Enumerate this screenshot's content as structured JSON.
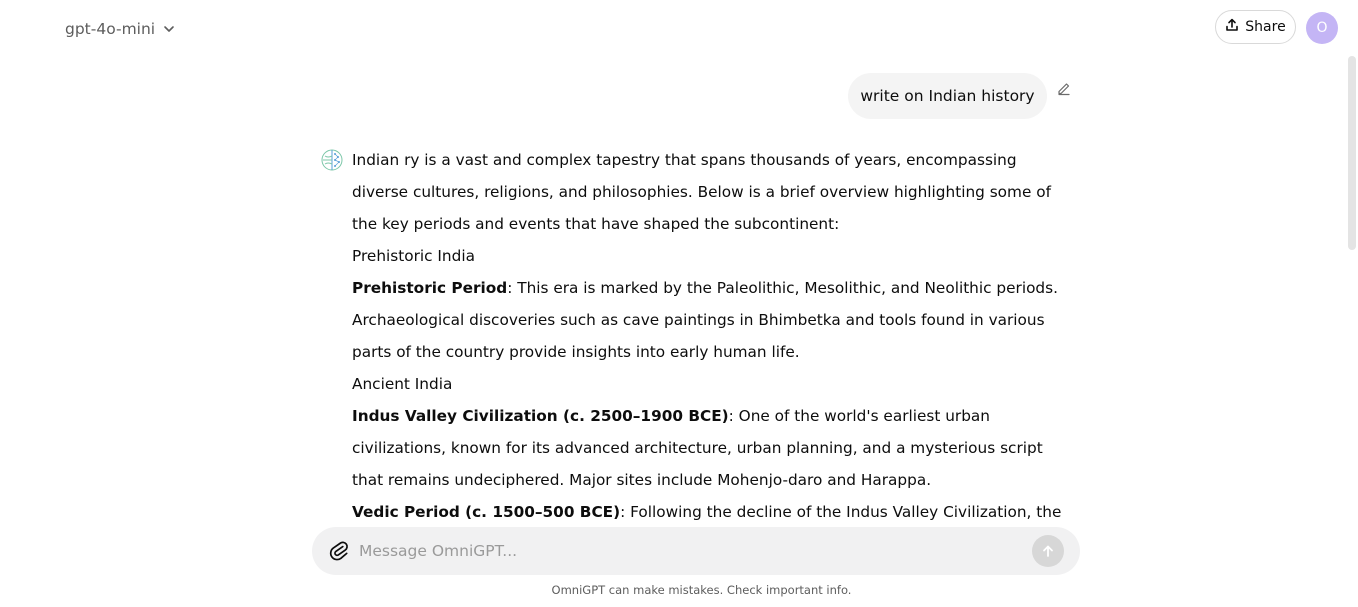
{
  "header": {
    "model_label": "gpt-4o-mini",
    "share_label": "Share",
    "avatar_initial": "O"
  },
  "user_message": {
    "text": "write on Indian history"
  },
  "assistant_message": {
    "intro": "Indian ry is a vast and complex tapestry that spans thousands of years, encompassing diverse cultures, religions, and philosophies. Below is a brief overview highlighting some of the key periods and events that have shaped the subcontinent:",
    "sections": [
      {
        "heading": "Prehistoric India",
        "items": [
          {
            "title": "Prehistoric Period",
            "text": ": This era is marked by the Paleolithic, Mesolithic, and Neolithic periods. Archaeological discoveries such as cave paintings in Bhimbetka and tools found in various parts of the country provide insights into early human life."
          }
        ]
      },
      {
        "heading": "Ancient India",
        "items": [
          {
            "title": "Indus Valley Civilization (c. 2500–1900 BCE)",
            "text": ": One of the world's earliest urban civilizations, known for its advanced architecture, urban planning, and a mysterious script that remains undeciphered. Major sites include Mohenjo-daro and Harappa."
          },
          {
            "title": "Vedic Period (c. 1500–500 BCE)",
            "text": ": Following the decline of the Indus Valley Civilization, the Vedic"
          }
        ]
      }
    ]
  },
  "composer": {
    "placeholder": "Message OmniGPT..."
  },
  "footer": {
    "note": "OmniGPT can make mistakes. Check important info."
  },
  "colors": {
    "avatar_bg": "#c4b5f5",
    "bubble_bg": "#f4f4f4",
    "composer_bg": "#f1f1f2",
    "send_disabled": "#d7d7d7"
  }
}
